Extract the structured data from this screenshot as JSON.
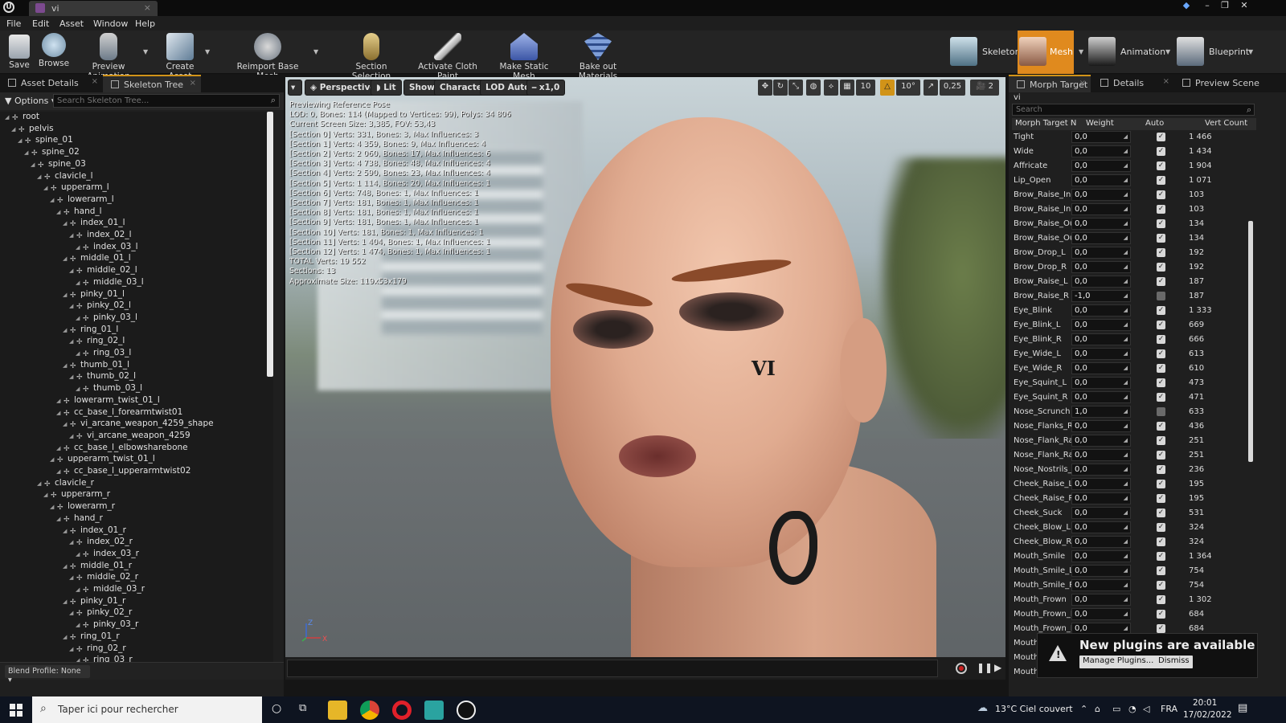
{
  "window": {
    "tab_title": "vi",
    "logo": "U"
  },
  "menu": [
    "File",
    "Edit",
    "Asset",
    "Window",
    "Help"
  ],
  "toolbar": {
    "save": "Save",
    "browse": "Browse",
    "preview_animation": "Preview Animation",
    "create_asset": "Create Asset",
    "reimport_base_mesh": "Reimport Base Mesh",
    "section_selection": "Section Selection",
    "activate_cloth_paint": "Activate Cloth Paint",
    "make_static_mesh": "Make Static Mesh",
    "bake_out_materials": "Bake out Materials"
  },
  "modes": {
    "skeleton": "Skeleton",
    "mesh": "Mesh",
    "animation": "Animation",
    "blueprint": "Blueprint"
  },
  "left": {
    "tab_asset_details": "Asset Details",
    "tab_skeleton_tree": "Skeleton Tree",
    "options": "Options",
    "search_placeholder": "Search Skeleton Tree...",
    "blend_profile": "Blend Profile: None",
    "tree": [
      {
        "name": "root",
        "depth": 0
      },
      {
        "name": "pelvis",
        "depth": 1
      },
      {
        "name": "spine_01",
        "depth": 2
      },
      {
        "name": "spine_02",
        "depth": 3
      },
      {
        "name": "spine_03",
        "depth": 4
      },
      {
        "name": "clavicle_l",
        "depth": 5
      },
      {
        "name": "upperarm_l",
        "depth": 6
      },
      {
        "name": "lowerarm_l",
        "depth": 7
      },
      {
        "name": "hand_l",
        "depth": 8
      },
      {
        "name": "index_01_l",
        "depth": 9
      },
      {
        "name": "index_02_l",
        "depth": 10
      },
      {
        "name": "index_03_l",
        "depth": 11
      },
      {
        "name": "middle_01_l",
        "depth": 9
      },
      {
        "name": "middle_02_l",
        "depth": 10
      },
      {
        "name": "middle_03_l",
        "depth": 11
      },
      {
        "name": "pinky_01_l",
        "depth": 9
      },
      {
        "name": "pinky_02_l",
        "depth": 10
      },
      {
        "name": "pinky_03_l",
        "depth": 11
      },
      {
        "name": "ring_01_l",
        "depth": 9
      },
      {
        "name": "ring_02_l",
        "depth": 10
      },
      {
        "name": "ring_03_l",
        "depth": 11
      },
      {
        "name": "thumb_01_l",
        "depth": 9
      },
      {
        "name": "thumb_02_l",
        "depth": 10
      },
      {
        "name": "thumb_03_l",
        "depth": 11
      },
      {
        "name": "lowerarm_twist_01_l",
        "depth": 8
      },
      {
        "name": "cc_base_l_forearmtwist01",
        "depth": 8
      },
      {
        "name": "vi_arcane_weapon_4259_shape",
        "depth": 9
      },
      {
        "name": "vi_arcane_weapon_4259",
        "depth": 10
      },
      {
        "name": "cc_base_l_elbowsharebone",
        "depth": 8
      },
      {
        "name": "upperarm_twist_01_l",
        "depth": 7
      },
      {
        "name": "cc_base_l_upperarmtwist02",
        "depth": 8
      },
      {
        "name": "clavicle_r",
        "depth": 5
      },
      {
        "name": "upperarm_r",
        "depth": 6
      },
      {
        "name": "lowerarm_r",
        "depth": 7
      },
      {
        "name": "hand_r",
        "depth": 8
      },
      {
        "name": "index_01_r",
        "depth": 9
      },
      {
        "name": "index_02_r",
        "depth": 10
      },
      {
        "name": "index_03_r",
        "depth": 11
      },
      {
        "name": "middle_01_r",
        "depth": 9
      },
      {
        "name": "middle_02_r",
        "depth": 10
      },
      {
        "name": "middle_03_r",
        "depth": 11
      },
      {
        "name": "pinky_01_r",
        "depth": 9
      },
      {
        "name": "pinky_02_r",
        "depth": 10
      },
      {
        "name": "pinky_03_r",
        "depth": 11
      },
      {
        "name": "ring_01_r",
        "depth": 9
      },
      {
        "name": "ring_02_r",
        "depth": 10
      },
      {
        "name": "ring_03_r",
        "depth": 11
      }
    ]
  },
  "viewport": {
    "perspective": "Perspective",
    "lit": "Lit",
    "show": "Show",
    "character": "Character",
    "lod": "LOD Auto",
    "speed": "x1,0",
    "grid_snap": "10",
    "rot_snap": "10°",
    "scale_snap": "0,25",
    "cam_speed": "2",
    "stats": [
      "Previewing Reference Pose",
      "LOD: 0, Bones: 114 (Mapped to Vertices: 99), Polys: 34 806",
      "Current Screen Size: 3,385, FOV: 53,43",
      "[Section 0] Verts: 331, Bones: 3, Max Influences: 3",
      "[Section 1] Verts: 4 359, Bones: 9, Max Influences: 4",
      "[Section 2] Verts: 2 060, Bones: 17, Max Influences: 6",
      "[Section 3] Verts: 4 738, Bones: 48, Max Influences: 4",
      "[Section 4] Verts: 2 590, Bones: 23, Max Influences: 4",
      "[Section 5] Verts: 1 114, Bones: 20, Max Influences: 1",
      "[Section 6] Verts: 748, Bones: 1, Max Influences: 1",
      "[Section 7] Verts: 181, Bones: 1, Max Influences: 1",
      "[Section 8] Verts: 181, Bones: 1, Max Influences: 1",
      "[Section 9] Verts: 181, Bones: 1, Max Influences: 1",
      "[Section 10] Verts: 181, Bones: 1, Max Influences: 1",
      "[Section 11] Verts: 1 404, Bones: 1, Max Influences: 1",
      "[Section 12] Verts: 1 474, Bones: 1, Max Influences: 1",
      "TOTAL Verts: 19 552",
      "Sections: 13",
      "Approximate Size: 119x53x179"
    ],
    "face_mark": "VI",
    "axis_z": "Z",
    "axis_x": "X"
  },
  "right": {
    "tab_morph": "Morph Target",
    "tab_details": "Details",
    "tab_preview": "Preview Scene",
    "asset_name": "vi",
    "search_placeholder": "Search",
    "col_name": "Morph Target N",
    "col_weight": "Weight",
    "col_auto": "Auto",
    "col_vert": "Vert Count",
    "rows": [
      {
        "name": "Tight",
        "weight": "0,0",
        "auto": true,
        "verts": "1 466"
      },
      {
        "name": "Wide",
        "weight": "0,0",
        "auto": true,
        "verts": "1 434"
      },
      {
        "name": "Affricate",
        "weight": "0,0",
        "auto": true,
        "verts": "1 904"
      },
      {
        "name": "Lip_Open",
        "weight": "0,0",
        "auto": true,
        "verts": "1 071"
      },
      {
        "name": "Brow_Raise_Inn",
        "weight": "0,0",
        "auto": true,
        "verts": "103"
      },
      {
        "name": "Brow_Raise_Inn",
        "weight": "0,0",
        "auto": true,
        "verts": "103"
      },
      {
        "name": "Brow_Raise_Out",
        "weight": "0,0",
        "auto": true,
        "verts": "134"
      },
      {
        "name": "Brow_Raise_Out",
        "weight": "0,0",
        "auto": true,
        "verts": "134"
      },
      {
        "name": "Brow_Drop_L",
        "weight": "0,0",
        "auto": true,
        "verts": "192"
      },
      {
        "name": "Brow_Drop_R",
        "weight": "0,0",
        "auto": true,
        "verts": "192"
      },
      {
        "name": "Brow_Raise_L",
        "weight": "0,0",
        "auto": true,
        "verts": "187"
      },
      {
        "name": "Brow_Raise_R",
        "weight": "-1,0",
        "auto": false,
        "verts": "187"
      },
      {
        "name": "Eye_Blink",
        "weight": "0,0",
        "auto": true,
        "verts": "1 333"
      },
      {
        "name": "Eye_Blink_L",
        "weight": "0,0",
        "auto": true,
        "verts": "669"
      },
      {
        "name": "Eye_Blink_R",
        "weight": "0,0",
        "auto": true,
        "verts": "666"
      },
      {
        "name": "Eye_Wide_L",
        "weight": "0,0",
        "auto": true,
        "verts": "613"
      },
      {
        "name": "Eye_Wide_R",
        "weight": "0,0",
        "auto": true,
        "verts": "610"
      },
      {
        "name": "Eye_Squint_L",
        "weight": "0,0",
        "auto": true,
        "verts": "473"
      },
      {
        "name": "Eye_Squint_R",
        "weight": "0,0",
        "auto": true,
        "verts": "471"
      },
      {
        "name": "Nose_Scrunch",
        "weight": "1,0",
        "auto": false,
        "verts": "633"
      },
      {
        "name": "Nose_Flanks_Ra",
        "weight": "0,0",
        "auto": true,
        "verts": "436"
      },
      {
        "name": "Nose_Flank_Rai",
        "weight": "0,0",
        "auto": true,
        "verts": "251"
      },
      {
        "name": "Nose_Flank_Rai",
        "weight": "0,0",
        "auto": true,
        "verts": "251"
      },
      {
        "name": "Nose_Nostrils_F",
        "weight": "0,0",
        "auto": true,
        "verts": "236"
      },
      {
        "name": "Cheek_Raise_L",
        "weight": "0,0",
        "auto": true,
        "verts": "195"
      },
      {
        "name": "Cheek_Raise_R",
        "weight": "0,0",
        "auto": true,
        "verts": "195"
      },
      {
        "name": "Cheek_Suck",
        "weight": "0,0",
        "auto": true,
        "verts": "531"
      },
      {
        "name": "Cheek_Blow_L",
        "weight": "0,0",
        "auto": true,
        "verts": "324"
      },
      {
        "name": "Cheek_Blow_R",
        "weight": "0,0",
        "auto": true,
        "verts": "324"
      },
      {
        "name": "Mouth_Smile",
        "weight": "0,0",
        "auto": true,
        "verts": "1 364"
      },
      {
        "name": "Mouth_Smile_L",
        "weight": "0,0",
        "auto": true,
        "verts": "754"
      },
      {
        "name": "Mouth_Smile_R",
        "weight": "0,0",
        "auto": true,
        "verts": "754"
      },
      {
        "name": "Mouth_Frown",
        "weight": "0,0",
        "auto": true,
        "verts": "1 302"
      },
      {
        "name": "Mouth_Frown_L",
        "weight": "0,0",
        "auto": true,
        "verts": "684"
      },
      {
        "name": "Mouth_Frown_R",
        "weight": "0,0",
        "auto": true,
        "verts": "684"
      },
      {
        "name": "Mouth",
        "weight": "",
        "auto": false,
        "verts": ""
      },
      {
        "name": "Mouth",
        "weight": "",
        "auto": false,
        "verts": ""
      },
      {
        "name": "Mouth",
        "weight": "",
        "auto": false,
        "verts": ""
      }
    ]
  },
  "notification": {
    "title": "New plugins are available",
    "manage": "Manage Plugins...",
    "dismiss": "Dismiss"
  },
  "taskbar": {
    "search": "Taper ici pour rechercher",
    "weather": "13°C  Ciel couvert",
    "lang": "FRA",
    "time": "20:01",
    "date": "17/02/2022"
  },
  "colors": {
    "accent": "#d19318",
    "mesh_mode": "#e08a1e"
  }
}
